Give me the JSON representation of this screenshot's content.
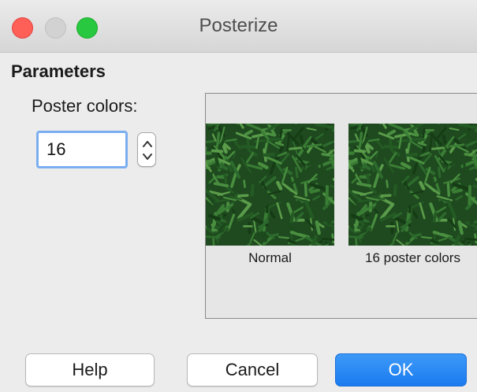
{
  "window": {
    "title": "Posterize"
  },
  "parameters": {
    "section_title": "Parameters",
    "poster_colors_label": "Poster colors:",
    "poster_colors_value": "16"
  },
  "preview": {
    "normal_caption": "Normal",
    "posterized_caption": "16 poster colors"
  },
  "buttons": {
    "help": "Help",
    "cancel": "Cancel",
    "ok": "OK"
  },
  "colors": {
    "accent": "#1b7bf0",
    "close": "#fe5f57",
    "minimize": "#d2d2d2",
    "maximize": "#28c840",
    "grass": "#2d6a2d"
  }
}
